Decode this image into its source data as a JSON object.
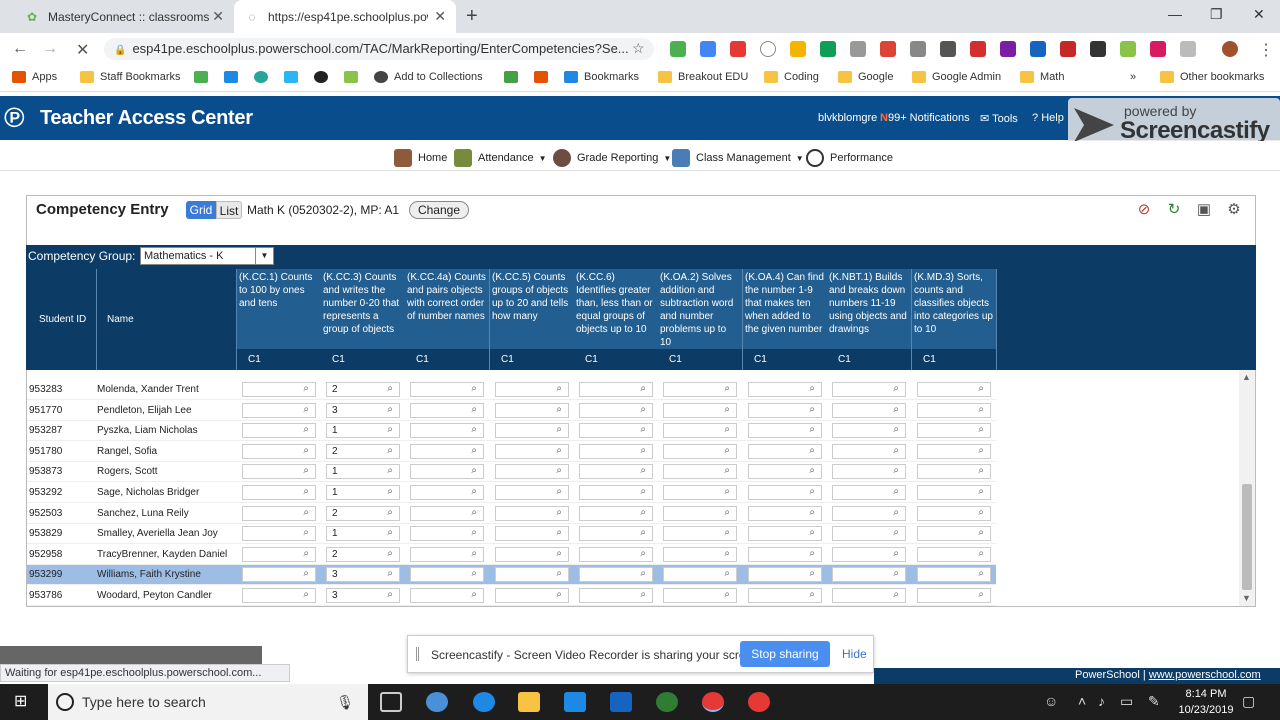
{
  "browser": {
    "tabs": [
      {
        "title": "MasteryConnect :: classrooms",
        "active": false
      },
      {
        "title": "https://esp41pe.schoolplus.pow",
        "active": true
      }
    ],
    "url": "esp41pe.eschoolplus.powerschool.com/TAC/MarkReporting/EnterCompetencies?Se...",
    "bookmarks": [
      "Apps",
      "Staff Bookmarks",
      "Add to Collections",
      "Bookmarks",
      "Breakout EDU",
      "Coding",
      "Google",
      "Google Admin",
      "Math",
      "Other bookmarks"
    ],
    "status": "Waiting for esp41pe.eschoolplus.powerschool.com..."
  },
  "app": {
    "title": "Teacher Access Center",
    "user": "blvkblomgre",
    "notifications": "99+ Notifications",
    "tools": "Tools",
    "help": "Help",
    "watermark_top": "powered by",
    "watermark_main": "Screencastify",
    "menu": [
      "Home",
      "Attendance",
      "Grade Reporting",
      "Class Management",
      "Performance"
    ]
  },
  "panel": {
    "title": "Competency Entry",
    "grid_label": "Grid",
    "list_label": "List",
    "course": "Math K (0520302-2), MP: A1",
    "change_label": "Change",
    "group_label": "Competency Group:",
    "group_value": "Mathematics - K",
    "col_student_id": "Student ID",
    "col_name": "Name",
    "competencies": [
      {
        "label": "(K.CC.1) Counts to 100 by ones and tens",
        "code": "C1"
      },
      {
        "label": "(K.CC.3) Counts and writes the number 0-20 that represents a group of objects",
        "code": "C1"
      },
      {
        "label": "(K.CC.4a) Counts and pairs objects with correct order of number names",
        "code": "C1"
      },
      {
        "label": "(K.CC.5) Counts groups of objects up to 20 and tells how many",
        "code": "C1"
      },
      {
        "label": "(K.CC.6) Identifies greater than, less than or equal groups of objects up to 10",
        "code": "C1"
      },
      {
        "label": "(K.OA.2) Solves addition and subtraction word and number problems up to 10",
        "code": "C1"
      },
      {
        "label": "(K.OA.4) Can find the number 1-9 that makes ten when added to the given number",
        "code": "C1"
      },
      {
        "label": "(K.NBT.1) Builds and breaks down numbers 11-19 using objects and drawings",
        "code": "C1"
      },
      {
        "label": "(K.MD.3) Sorts, counts and classifies objects into categories up to 10",
        "code": "C1"
      }
    ],
    "rows": [
      {
        "id": "953283",
        "name": "Molenda, Xander Trent",
        "values": [
          "",
          "2",
          "",
          "",
          "",
          "",
          "",
          "",
          ""
        ],
        "selected": false
      },
      {
        "id": "951770",
        "name": "Pendleton, Elijah Lee",
        "values": [
          "",
          "3",
          "",
          "",
          "",
          "",
          "",
          "",
          ""
        ],
        "selected": false
      },
      {
        "id": "953287",
        "name": "Pyszka, Liam Nicholas",
        "values": [
          "",
          "1",
          "",
          "",
          "",
          "",
          "",
          "",
          ""
        ],
        "selected": false
      },
      {
        "id": "951780",
        "name": "Rangel, Sofia",
        "values": [
          "",
          "2",
          "",
          "",
          "",
          "",
          "",
          "",
          ""
        ],
        "selected": false
      },
      {
        "id": "953873",
        "name": "Rogers, Scott",
        "values": [
          "",
          "1",
          "",
          "",
          "",
          "",
          "",
          "",
          ""
        ],
        "selected": false
      },
      {
        "id": "953292",
        "name": "Sage, Nicholas Bridger",
        "values": [
          "",
          "1",
          "",
          "",
          "",
          "",
          "",
          "",
          ""
        ],
        "selected": false
      },
      {
        "id": "952503",
        "name": "Sanchez, Luna Reily",
        "values": [
          "",
          "2",
          "",
          "",
          "",
          "",
          "",
          "",
          ""
        ],
        "selected": false
      },
      {
        "id": "953829",
        "name": "Smalley, Averiella Jean Joy",
        "values": [
          "",
          "1",
          "",
          "",
          "",
          "",
          "",
          "",
          ""
        ],
        "selected": false
      },
      {
        "id": "952958",
        "name": "TracyBrenner, Kayden Daniel",
        "values": [
          "",
          "2",
          "",
          "",
          "",
          "",
          "",
          "",
          ""
        ],
        "selected": false
      },
      {
        "id": "953299",
        "name": "Williams, Faith Krystine",
        "values": [
          "",
          "3",
          "",
          "",
          "",
          "",
          "",
          "",
          ""
        ],
        "selected": true
      },
      {
        "id": "953786",
        "name": "Woodard, Peyton Candler",
        "values": [
          "",
          "3",
          "",
          "",
          "",
          "",
          "",
          "",
          ""
        ],
        "selected": false
      }
    ]
  },
  "share": {
    "text": "Screencastify - Screen Video Recorder is sharing your screen.",
    "stop": "Stop sharing",
    "hide": "Hide"
  },
  "footer": {
    "brand": "PowerSchool",
    "sep": "|",
    "link": "www.powerschool.com"
  },
  "taskbar": {
    "search": "Type here to search",
    "time": "8:14 PM",
    "date": "10/23/2019"
  },
  "colors": {
    "header": "#0a4d8c",
    "table_header": "#0c3c66",
    "selected_row": "#9dbde5",
    "accent": "#3a7bd5"
  }
}
